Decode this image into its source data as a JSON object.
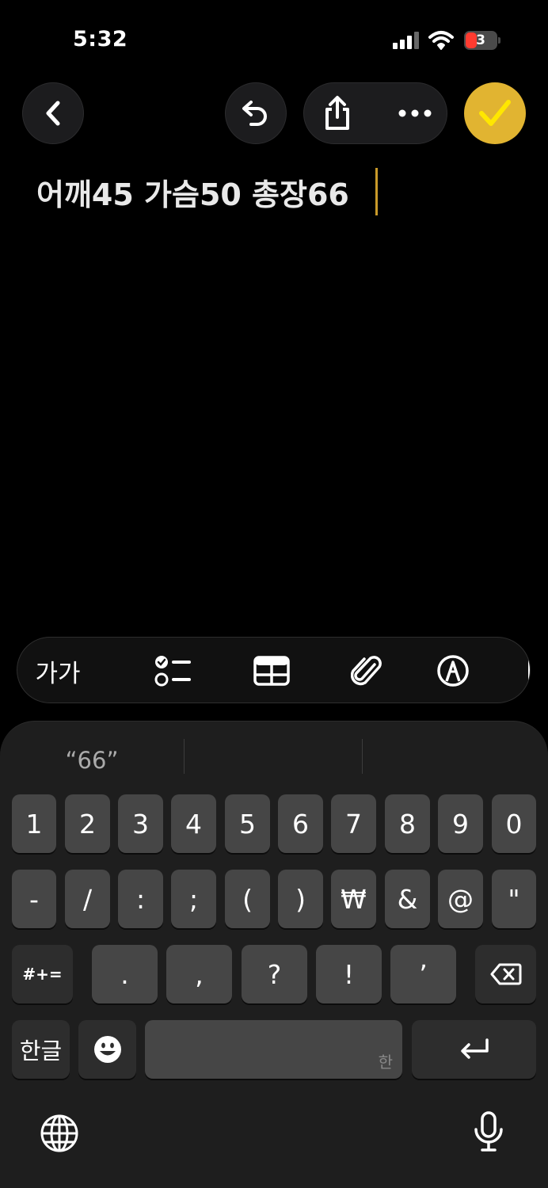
{
  "status_bar": {
    "time": "5:32",
    "battery_level": "3"
  },
  "note": {
    "text": "어깨45 가슴50 총장66"
  },
  "format_bar": {
    "text_style_label": "가가"
  },
  "keyboard": {
    "suggestions": [
      "“66”",
      "",
      ""
    ],
    "row1": [
      "1",
      "2",
      "3",
      "4",
      "5",
      "6",
      "7",
      "8",
      "9",
      "0"
    ],
    "row2": [
      "-",
      "/",
      ":",
      ";",
      "(",
      ")",
      "₩",
      "&",
      "@",
      "\""
    ],
    "row3_toggle": "#+=",
    "row3": [
      ".",
      ",",
      "?",
      "!",
      "’"
    ],
    "lang_key": "한글",
    "space_hint": "한"
  },
  "colors": {
    "accent": "#e1b431",
    "checkmark": "#ffe700",
    "cursor": "#c99a2a"
  }
}
